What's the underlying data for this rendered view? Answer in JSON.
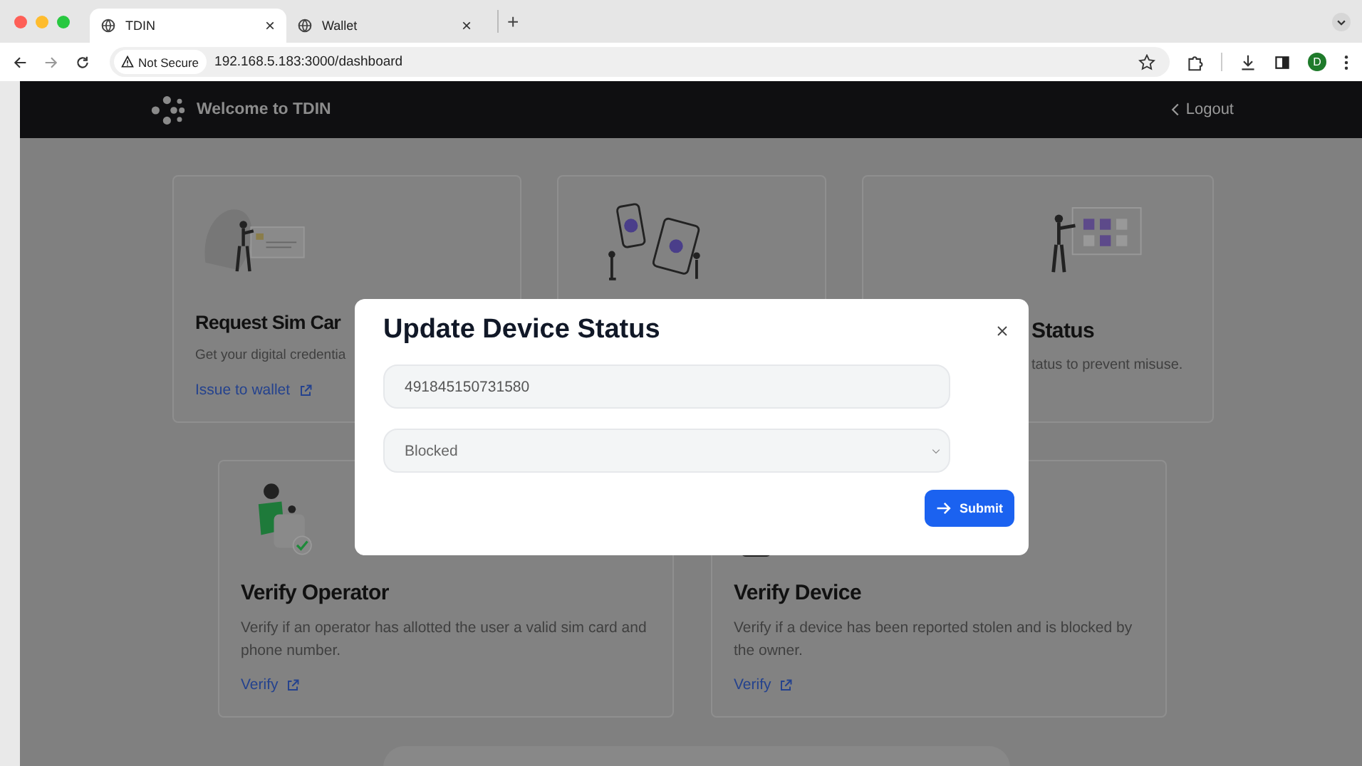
{
  "browser": {
    "tabs": [
      {
        "title": "TDIN",
        "selected": true,
        "close": "×"
      },
      {
        "title": "Wallet",
        "selected": false,
        "close": "×"
      }
    ],
    "new_tab": "+",
    "security_label": "Not Secure",
    "url": "192.168.5.183:3000/dashboard",
    "profile_initial": "D"
  },
  "header": {
    "title": "Welcome to TDIN",
    "logout": "Logout"
  },
  "top_cards": [
    {
      "kind": "sim",
      "title": "Request Sim Car",
      "description": "Get your digital credentia",
      "link": "Issue to wallet"
    },
    {
      "kind": "devices"
    },
    {
      "kind": "status",
      "title": "Status",
      "description": "tatus to prevent misuse."
    }
  ],
  "bottom_cards": [
    {
      "kind": "operator",
      "title": "Verify Operator",
      "description": "Verify if an operator has allotted the user a valid sim card and phone number.",
      "link": "Verify"
    },
    {
      "kind": "device",
      "title": "Verify Device",
      "description": "Verify if a device has been reported stolen and is blocked by the owner.",
      "link": "Verify"
    }
  ],
  "modal": {
    "title": "Update Device Status",
    "device_field": {
      "value": "491845150731580"
    },
    "status_select": {
      "value": "Blocked"
    },
    "submit": "Submit"
  }
}
